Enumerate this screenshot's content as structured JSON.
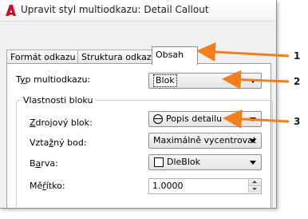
{
  "window": {
    "title": "Upravit styl multiodkazu: Detail Callout"
  },
  "tabs": [
    {
      "label": "Formát odkazu",
      "active": false
    },
    {
      "label": "Struktura odkazu",
      "active": false
    },
    {
      "label": "Obsah",
      "active": true
    }
  ],
  "content": {
    "type_label_pre": "T",
    "type_label_u": "y",
    "type_label_post": "p multiodkazu:",
    "type_value": "Blok",
    "group_title": "Vlastnosti bloku",
    "source_label_u": "Z",
    "source_label_post": "drojový blok:",
    "source_value": "Popis detailu",
    "attach_label_pre": "Vzta",
    "attach_label_u": "ž",
    "attach_label_post": "ný bod:",
    "attach_value": "Maximálně vycentrovat",
    "color_label_pre": "B",
    "color_label_u": "a",
    "color_label_post": "rva:",
    "color_value": "DleBlok",
    "scale_label_pre": "Mě",
    "scale_label_u": "ř",
    "scale_label_post": "ítko:",
    "scale_value": "1.0000"
  },
  "callouts": [
    {
      "number": "1"
    },
    {
      "number": "2"
    },
    {
      "number": "3"
    }
  ],
  "colors": {
    "arrow": "#f07f1e",
    "app_icon": "#c8102e"
  },
  "icons": {
    "app": "autocad-logo-icon",
    "source_block": "detail-callout-symbol-icon",
    "color_swatch": "white-swatch-icon"
  }
}
